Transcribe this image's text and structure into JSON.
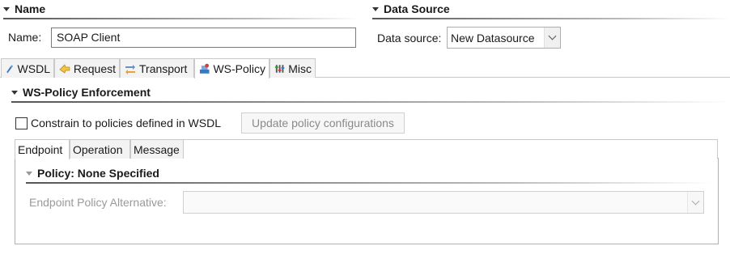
{
  "name_section": {
    "header": "Name",
    "name_label": "Name:",
    "name_value": "SOAP Client"
  },
  "data_source_section": {
    "header": "Data Source",
    "label": "Data source:",
    "selected": "New Datasource"
  },
  "tabs": [
    {
      "label": "WSDL",
      "icon": "wsdl-icon"
    },
    {
      "label": "Request",
      "icon": "request-icon"
    },
    {
      "label": "Transport",
      "icon": "transport-icon"
    },
    {
      "label": "WS-Policy",
      "icon": "ws-policy-icon",
      "active": true
    },
    {
      "label": "Misc",
      "icon": "misc-icon"
    }
  ],
  "ws_policy": {
    "header": "WS-Policy Enforcement",
    "constrain_label": "Constrain to policies defined in WSDL",
    "constrain_checked": false,
    "update_button": "Update policy configurations",
    "subtabs": [
      "Endpoint",
      "Operation",
      "Message"
    ],
    "active_subtab": "Endpoint",
    "policy_header": "Policy: None Specified",
    "alternative_label": "Endpoint Policy Alternative:",
    "alternative_value": ""
  },
  "colors": {
    "tab_border": "#c9c9c9",
    "disabled_text": "#9a9a9a"
  }
}
